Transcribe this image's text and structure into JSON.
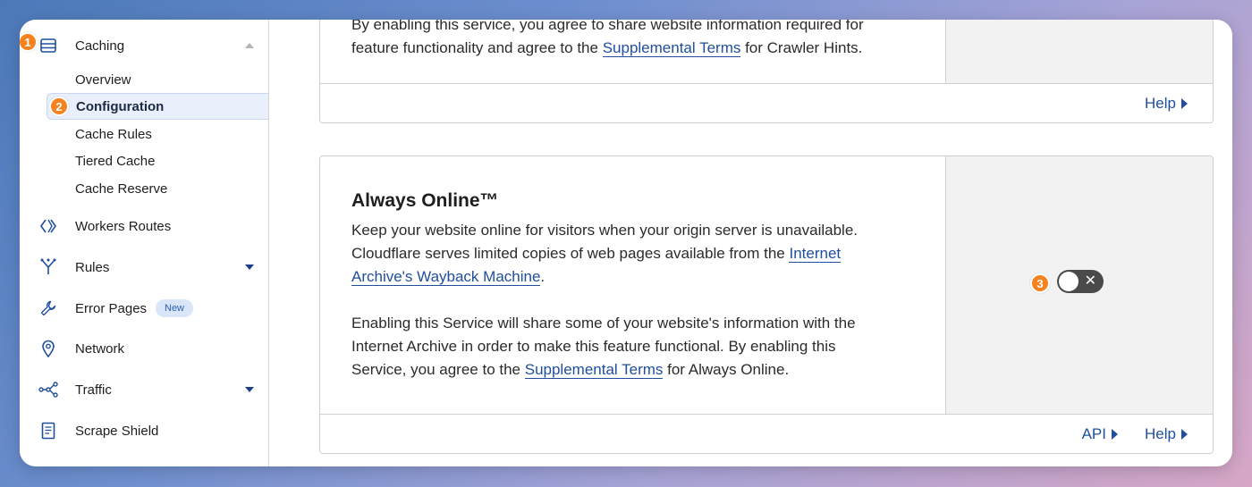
{
  "sidebar": {
    "caching": {
      "label": "Caching",
      "icon": "storage-icon"
    },
    "sub_items": [
      {
        "label": "Overview"
      },
      {
        "label": "Configuration"
      },
      {
        "label": "Cache Rules"
      },
      {
        "label": "Tiered Cache"
      },
      {
        "label": "Cache Reserve"
      }
    ],
    "items": [
      {
        "label": "Workers Routes",
        "icon": "workers-icon"
      },
      {
        "label": "Rules",
        "icon": "rules-icon"
      },
      {
        "label": "Error Pages",
        "icon": "wrench-icon",
        "badge": "New"
      },
      {
        "label": "Network",
        "icon": "location-pin-icon"
      },
      {
        "label": "Traffic",
        "icon": "traffic-icon"
      },
      {
        "label": "Scrape Shield",
        "icon": "document-icon"
      }
    ]
  },
  "steps": [
    "1",
    "2",
    "3"
  ],
  "crawler_card": {
    "text_line1": "By enabling this service, you agree to share website information required for",
    "text_line2_pre": "feature functionality and agree to the ",
    "text_line2_link": "Supplemental Terms",
    "text_line2_post": " for Crawler Hints.",
    "help": "Help"
  },
  "always_online": {
    "title": "Always Online™",
    "p1_line1": "Keep your website online for visitors when your origin server is unavailable.",
    "p1_line2_pre": "Cloudflare serves limited copies of web pages available from the ",
    "p1_link_part1": "Internet",
    "p1_link_part2": "Archive's Wayback Machine",
    "p1_post": ".",
    "p2_line1": "Enabling this Service will share some of your website's information with the",
    "p2_line2": "Internet Archive in order to make this feature functional. By enabling this",
    "p2_line3_pre": "Service, you agree to the ",
    "p2_link": "Supplemental Terms",
    "p2_post": " for Always Online.",
    "toggle_state": "off",
    "api": "API",
    "help": "Help"
  },
  "colors": {
    "accent": "#1f4e9e",
    "step_badge": "#f5821f",
    "toggle_off": "#4a4a4a"
  }
}
